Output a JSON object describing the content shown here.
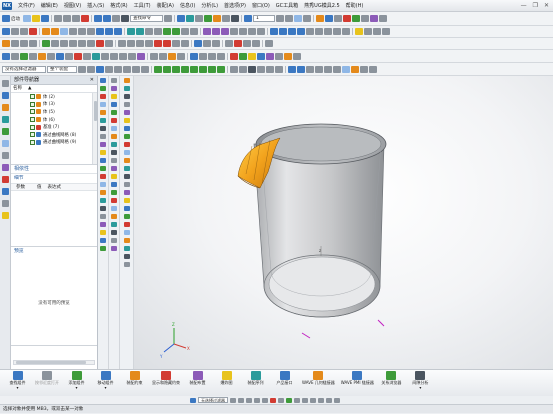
{
  "menubar": {
    "items": [
      "文件(F)",
      "编辑(E)",
      "视图(V)",
      "插入(S)",
      "格式(R)",
      "工具(T)",
      "装配(A)",
      "信息(I)",
      "分析(L)",
      "首选项(P)",
      "窗口(O)",
      "GC工具箱",
      "燕秀UG模具2.5",
      "帮助(H)"
    ],
    "window_controls": [
      "—",
      "❐",
      "✕"
    ]
  },
  "toolbar": {
    "start_label": "启动",
    "filter_dropdown": "整个装配",
    "command_search": "查找命令",
    "layer_dropdown": "1",
    "selection_filter": "没有选择过滤器",
    "selection_scope": "整个装配"
  },
  "navigator": {
    "title": "部件导航器",
    "close": "✕",
    "column": "名称",
    "tree": [
      {
        "label": "体 (2)",
        "color": "#e48a1b"
      },
      {
        "label": "体 (3)",
        "color": "#e48a1b"
      },
      {
        "label": "体 (5)",
        "color": "#e48a1b"
      },
      {
        "label": "体 (6)",
        "color": "#e48a1b"
      },
      {
        "label": "基准 (7)",
        "color": "#d23b32"
      },
      {
        "label": "通过曲线网格 (8)",
        "color": "#3b78c2"
      },
      {
        "label": "通过曲线网格 (9)",
        "color": "#3b78c2"
      }
    ],
    "dependency_label": "相依性",
    "details_label": "细节",
    "param_cols": [
      "参数",
      "值",
      "表达式"
    ],
    "preview_label": "预览",
    "preview_message": "没有可用的预览"
  },
  "viewport": {
    "background": "#f3f4f6",
    "cylinder_color": "#c8c9cb",
    "feature_color": "#f0a51c"
  },
  "ribbon": {
    "buttons": [
      {
        "label": "查找组件",
        "icon_color": "#3b78c2",
        "dropdown": true,
        "disabled": false
      },
      {
        "label": "按邻近度打开",
        "icon_color": "#8b939c",
        "dropdown": false,
        "disabled": true
      },
      {
        "label": "添加组件",
        "icon_color": "#3e9b3a",
        "dropdown": true,
        "disabled": false
      },
      {
        "label": "移动组件",
        "icon_color": "#3b78c2",
        "dropdown": true,
        "disabled": false
      },
      {
        "label": "装配约束",
        "icon_color": "#e48a1b",
        "dropdown": false,
        "disabled": false
      },
      {
        "label": "显示和隐藏约束",
        "icon_color": "#d23b32",
        "dropdown": false,
        "disabled": false
      },
      {
        "label": "装配布置",
        "icon_color": "#8c5bb8",
        "dropdown": false,
        "disabled": false
      },
      {
        "label": "爆炸图",
        "icon_color": "#e8c31c",
        "dropdown": false,
        "disabled": false
      },
      {
        "label": "装配序列",
        "icon_color": "#2b9b9b",
        "dropdown": false,
        "disabled": false
      },
      {
        "label": "产品接口",
        "icon_color": "#3b78c2",
        "dropdown": false,
        "disabled": false
      },
      {
        "label": "WAVE 几何链接器",
        "icon_color": "#e48a1b",
        "dropdown": false,
        "disabled": false
      },
      {
        "label": "WAVE PMI 链接器",
        "icon_color": "#3b78c2",
        "dropdown": false,
        "disabled": false
      },
      {
        "label": "关系浏览器",
        "icon_color": "#3e9b3a",
        "dropdown": false,
        "disabled": false
      },
      {
        "label": "间隙分析",
        "icon_color": "#4b5560",
        "dropdown": true,
        "disabled": false
      }
    ]
  },
  "snapbar": {
    "dropdown": "无选择过滤器"
  },
  "status": {
    "message": "选择对象并使用 MB3，或双击某一对象",
    "right": ""
  }
}
